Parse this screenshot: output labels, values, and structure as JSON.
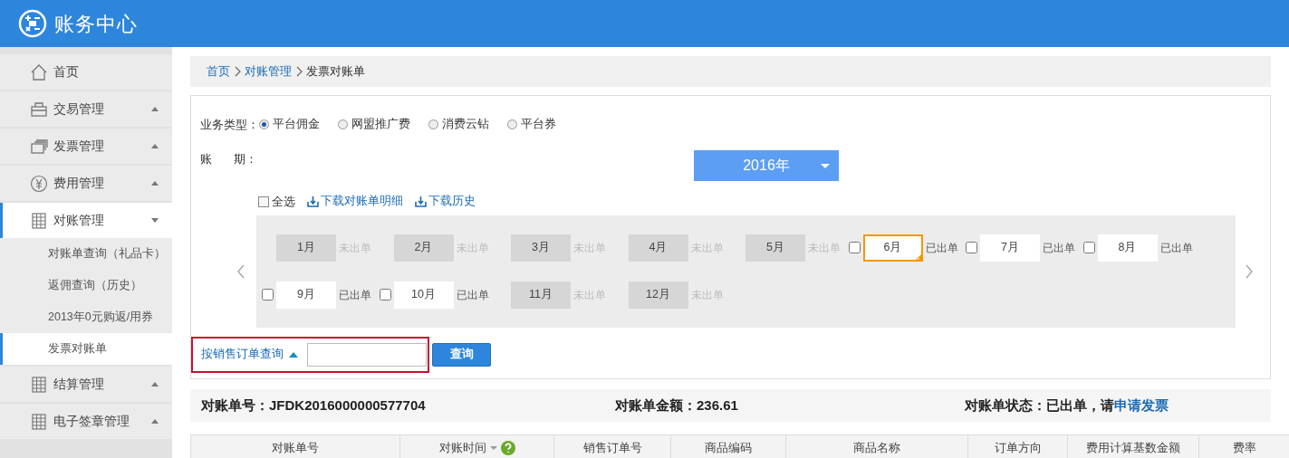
{
  "header": {
    "title": "账务中心"
  },
  "sidebar": {
    "items": [
      {
        "label": "首页",
        "selected": false
      },
      {
        "label": "交易管理",
        "selected": false,
        "expanded": false
      },
      {
        "label": "发票管理",
        "selected": false,
        "expanded": false
      },
      {
        "label": "费用管理",
        "selected": false,
        "expanded": false
      },
      {
        "label": "对账管理",
        "selected": true,
        "expanded": true,
        "children": [
          {
            "label": "对账单查询（礼品卡）",
            "selected": false
          },
          {
            "label": "返佣查询（历史）",
            "selected": false
          },
          {
            "label": "2013年0元购返/用券",
            "selected": false
          },
          {
            "label": "发票对账单",
            "selected": true
          }
        ]
      },
      {
        "label": "结算管理",
        "selected": false,
        "expanded": false
      },
      {
        "label": "电子签章管理",
        "selected": false,
        "expanded": false
      }
    ]
  },
  "breadcrumb": [
    {
      "label": "首页",
      "current": false
    },
    {
      "label": "对账管理",
      "current": false
    },
    {
      "label": "发票对账单",
      "current": true
    }
  ],
  "filters": {
    "business_type_label": "业务类型：",
    "business_types": [
      {
        "label": "平台佣金",
        "selected": true
      },
      {
        "label": "网盟推广费",
        "selected": false
      },
      {
        "label": "消费云钻",
        "selected": false
      },
      {
        "label": "平台券",
        "selected": false
      }
    ],
    "period_label_1": "账",
    "period_label_2": "期：",
    "year": "2016年"
  },
  "select_all": {
    "label": "全选",
    "checked": false
  },
  "download_links": [
    "下载对账单明细",
    "下载历史"
  ],
  "months": [
    {
      "label": "1月",
      "status": "未出单",
      "kind": "pending",
      "selected": false
    },
    {
      "label": "2月",
      "status": "未出单",
      "kind": "pending",
      "selected": false
    },
    {
      "label": "3月",
      "status": "未出单",
      "kind": "pending",
      "selected": false
    },
    {
      "label": "4月",
      "status": "未出单",
      "kind": "pending",
      "selected": false
    },
    {
      "label": "5月",
      "status": "未出单",
      "kind": "pending",
      "selected": false
    },
    {
      "label": "6月",
      "status": "已出单",
      "kind": "issued",
      "checked": false,
      "selected": true
    },
    {
      "label": "7月",
      "status": "已出单",
      "kind": "issued",
      "checked": false,
      "selected": false
    },
    {
      "label": "8月",
      "status": "已出单",
      "kind": "issued",
      "checked": false,
      "selected": false
    },
    {
      "label": "9月",
      "status": "已出单",
      "kind": "issued",
      "checked": false,
      "selected": false
    },
    {
      "label": "10月",
      "status": "已出单",
      "kind": "issued",
      "checked": false,
      "selected": false
    },
    {
      "label": "11月",
      "status": "未出单",
      "kind": "pending",
      "selected": false
    },
    {
      "label": "12月",
      "status": "未出单",
      "kind": "pending",
      "selected": false
    }
  ],
  "order_query": {
    "label": "按销售订单查询",
    "button": "查询"
  },
  "summary": {
    "number_label": "对账单号：",
    "number": "JFDK2016000000577704",
    "amount_label": "对账单金额：",
    "amount": "236.61",
    "status_label": "对账单状态：",
    "status": "已出单，请",
    "link": "申请发票"
  },
  "table": {
    "columns": [
      {
        "label": "对账单号",
        "sort": false
      },
      {
        "label": "对账时间",
        "sort": true
      },
      {
        "label": "销售订单号",
        "sort": false
      },
      {
        "label": "商品编码",
        "sort": false
      },
      {
        "label": "商品名称",
        "sort": false
      },
      {
        "label": "订单方向",
        "sort": false
      },
      {
        "label": "费用计算基数金额",
        "sort": false
      },
      {
        "label": "费率",
        "sort": false
      }
    ]
  }
}
